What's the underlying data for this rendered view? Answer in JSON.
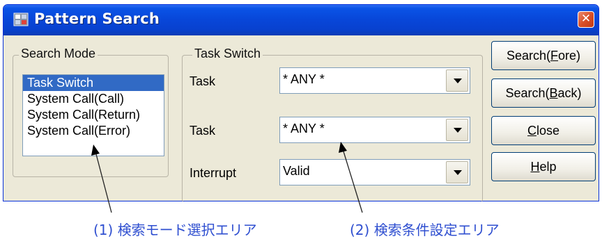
{
  "window": {
    "title": "Pattern Search",
    "close_symbol": "✕"
  },
  "search_mode": {
    "label": "Search Mode",
    "items": [
      {
        "label": "Task Switch",
        "selected": true
      },
      {
        "label": "System Call(Call)",
        "selected": false
      },
      {
        "label": "System Call(Return)",
        "selected": false
      },
      {
        "label": "System Call(Error)",
        "selected": false
      }
    ]
  },
  "task_switch": {
    "label": "Task Switch",
    "rows": [
      {
        "label": "Task",
        "value": "* ANY *"
      },
      {
        "label": "Task",
        "value": "* ANY *"
      },
      {
        "label": "Interrupt",
        "value": "Valid"
      }
    ]
  },
  "buttons": {
    "search_fore": {
      "pre": "Search(",
      "acc": "F",
      "post": "ore)"
    },
    "search_back": {
      "pre": "Search(",
      "acc": "B",
      "post": "ack)"
    },
    "close": {
      "pre": "",
      "acc": "C",
      "post": "lose"
    },
    "help": {
      "pre": "",
      "acc": "H",
      "post": "elp"
    }
  },
  "annotations": {
    "left": "(1) 検索モード選択エリア",
    "right": "(2) 検索条件設定エリア"
  },
  "colors": {
    "titlebar": "#0846d8",
    "selection": "#316ac5",
    "caption": "#2f4fd0"
  }
}
